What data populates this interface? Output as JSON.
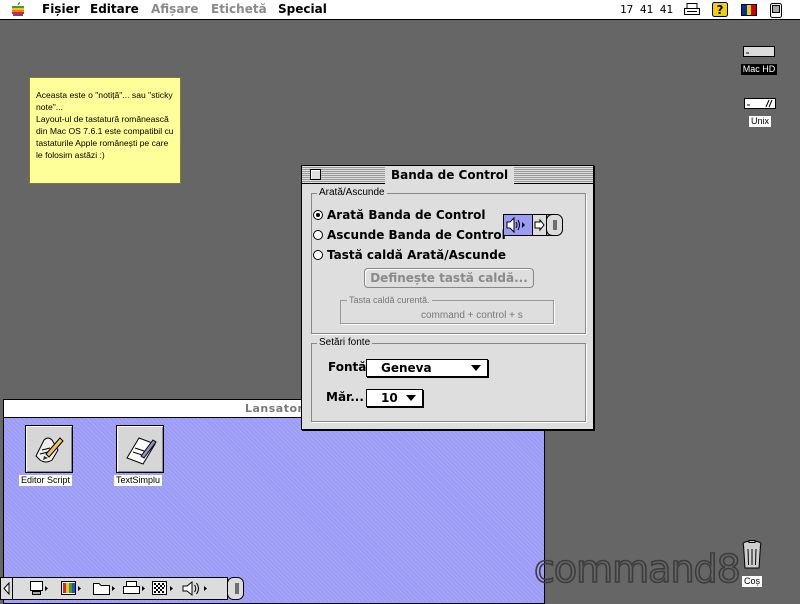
{
  "menubar": {
    "items": [
      {
        "label": "Fișier",
        "enabled": true
      },
      {
        "label": "Editare",
        "enabled": true
      },
      {
        "label": "Afișare",
        "enabled": false
      },
      {
        "label": "Etichetă",
        "enabled": false
      },
      {
        "label": "Special",
        "enabled": true
      }
    ],
    "clock": "17 41 41",
    "icons": [
      "apple-icon",
      "printer-icon",
      "help-icon",
      "keyboard-layout-flag-icon",
      "application-icon"
    ]
  },
  "desktop": {
    "icons": [
      {
        "label": "Mac HD",
        "icon": "hard-disk-icon"
      },
      {
        "label": "Unix",
        "icon": "disk-icon"
      },
      {
        "label": "Coș",
        "icon": "trash-icon"
      }
    ],
    "sticky_note": "Aceasta este o \"notiță\"... sau \"sticky note\"...\nLayout-ul de tastatură românească din Mac OS 7.6.1 este compatibil cu tastaturile Apple românești pe care le folosim astăzi :)",
    "watermark": "command8"
  },
  "launcher": {
    "title": "Lansator",
    "items": [
      {
        "label": "Editor Script",
        "icon": "script-editor-icon"
      },
      {
        "label": "TextSimplu",
        "icon": "simpletext-icon"
      }
    ]
  },
  "control_strip": {
    "modules": [
      "monitor-icon",
      "color-depth-icon",
      "folder-icon",
      "printer-icon",
      "resolution-icon",
      "sound-volume-icon"
    ]
  },
  "control_panel": {
    "title": "Banda de Control",
    "group_show_hide": {
      "label": "Arată/Ascunde",
      "options": [
        {
          "label": "Arată Banda de Control",
          "selected": true
        },
        {
          "label": "Ascunde Banda de Control",
          "selected": false
        },
        {
          "label": "Tastă caldă Arată/Ascunde",
          "selected": false
        }
      ],
      "define_button": "Definește tastă caldă...",
      "current_hotkey_label": "Tasta caldă curentă.",
      "current_hotkey_value": "command + control + s"
    },
    "group_fonts": {
      "label": "Setări fonte",
      "font_label": "Fontă:",
      "font_value": "Geneva",
      "size_label": "Măr...",
      "size_value": "10"
    }
  },
  "colors": {
    "desktop": "#666666",
    "sticky": "#ffff99",
    "launcher_bg": "#9c9cf7"
  }
}
